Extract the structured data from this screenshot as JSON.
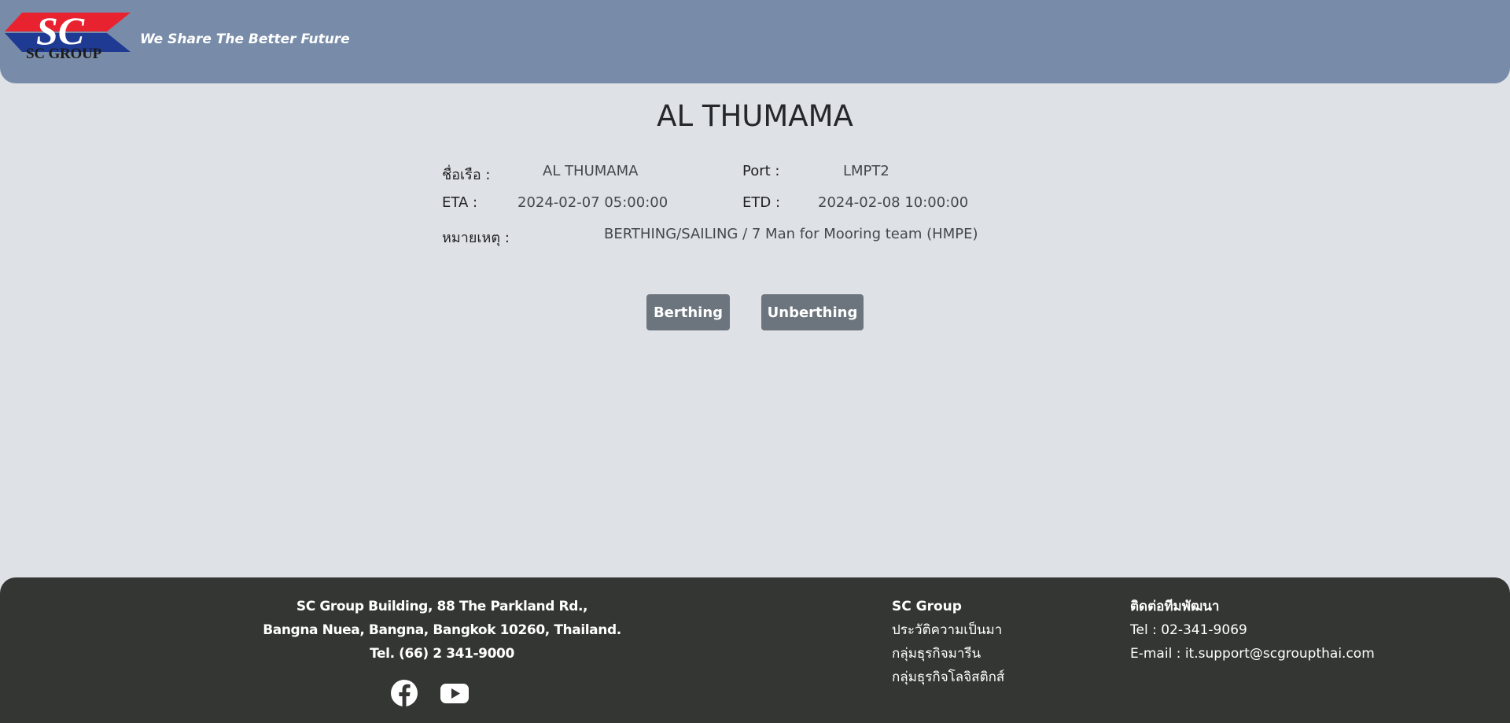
{
  "header": {
    "logo_mark": "SC",
    "logo_text": "SC GROUP",
    "tagline": "We Share The Better Future",
    "colors": {
      "background": "#788ca9",
      "logo_red": "#e8232f",
      "logo_blue": "#1f3a93"
    }
  },
  "page": {
    "title": "AL THUMAMA"
  },
  "details": {
    "vessel_name_label": "ชื่อเรือ :",
    "vessel_name_value": "AL THUMAMA",
    "port_label": "Port :",
    "port_value": "LMPT2",
    "eta_label": "ETA :",
    "eta_value": "2024-02-07 05:00:00",
    "etd_label": "ETD :",
    "etd_value": "2024-02-08 10:00:00",
    "remark_label": "หมายเหตุ :",
    "remark_value": "BERTHING/SAILING / 7 Man for Mooring team (HMPE)"
  },
  "actions": {
    "berthing_label": "Berthing",
    "unberthing_label": "Unberthing",
    "button_color": "#6c757d"
  },
  "footer": {
    "address_line1": "SC Group Building, 88 The Parkland Rd.,",
    "address_line2": "Bangna Nuea, Bangna, Bangkok 10260, Thailand.",
    "address_line3": "Tel. (66) 2 341-9000",
    "social_icons": [
      "facebook-icon",
      "youtube-icon"
    ],
    "col1_title": "SC Group",
    "col1_links": [
      "ประวัติความเป็นมา",
      "กลุ่มธุรกิจมารีน",
      "กลุ่มธุรกิจโลจิสติกส์"
    ],
    "col2_title": "ติดต่อทีมพัฒนา",
    "col2_tel": "Tel : 02-341-9069",
    "col2_email": "E-mail : it.support@scgroupthai.com",
    "background": "#343633"
  }
}
